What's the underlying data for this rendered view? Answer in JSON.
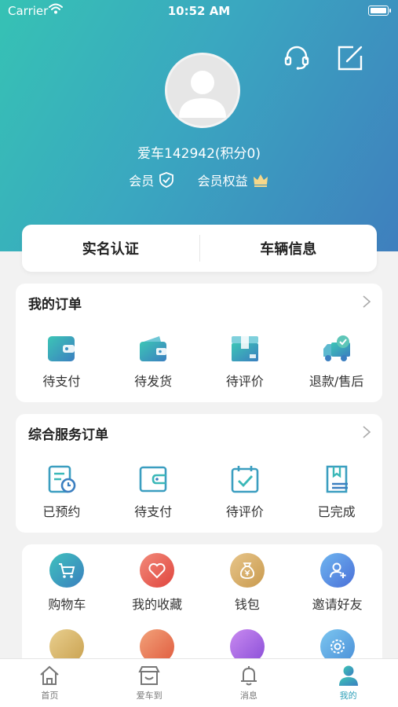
{
  "status_bar": {
    "carrier": "Carrier",
    "time": "10:52 AM"
  },
  "profile": {
    "username": "爱车142942(积分0)",
    "member_label": "会员",
    "benefits_label": "会员权益"
  },
  "top_tabs": [
    {
      "label": "实名认证"
    },
    {
      "label": "车辆信息"
    }
  ],
  "my_orders": {
    "title": "我的订单",
    "items": [
      {
        "label": "待支付",
        "icon": "wallet-icon"
      },
      {
        "label": "待发货",
        "icon": "purse-icon"
      },
      {
        "label": "待评价",
        "icon": "box-icon"
      },
      {
        "label": "退款/售后",
        "icon": "truck-icon"
      }
    ]
  },
  "service_orders": {
    "title": "综合服务订单",
    "items": [
      {
        "label": "已预约",
        "icon": "clock-document-icon"
      },
      {
        "label": "待支付",
        "icon": "wallet-outline-icon"
      },
      {
        "label": "待评价",
        "icon": "calendar-check-icon"
      },
      {
        "label": "已完成",
        "icon": "completed-doc-icon"
      }
    ]
  },
  "tools": {
    "items": [
      {
        "label": "购物车",
        "icon": "cart-icon"
      },
      {
        "label": "我的收藏",
        "icon": "heart-icon"
      },
      {
        "label": "钱包",
        "icon": "money-bag-icon"
      },
      {
        "label": "邀请好友",
        "icon": "invite-user-icon"
      }
    ]
  },
  "tab_bar": [
    {
      "label": "首页",
      "icon": "home-icon"
    },
    {
      "label": "爱车到",
      "icon": "store-icon"
    },
    {
      "label": "消息",
      "icon": "bell-icon"
    },
    {
      "label": "我的",
      "icon": "person-icon",
      "active": true
    }
  ],
  "colors": {
    "header_start": "#36c2b4",
    "header_end": "#3f7fbe",
    "accent": "#2e9fb8"
  }
}
